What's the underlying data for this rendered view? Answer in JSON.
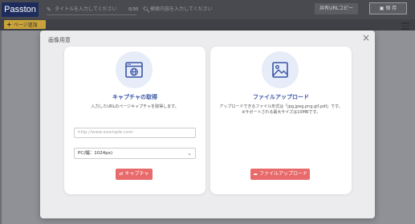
{
  "app": {
    "logo": "Passton",
    "title_placeholder": "タイトルを入力してください",
    "title_count": "0/30",
    "search_placeholder": "検索内容を入力してください",
    "share_label": "共有URLコピー",
    "save_label": "保 存",
    "page_add_label": "ページ追加"
  },
  "modal": {
    "title": "画像用意",
    "close_symbol": "×",
    "capture": {
      "title": "キャプチャの取得",
      "description": "入力したURLのページキャプチャを取得します。",
      "url_placeholder": "http://www.example.com",
      "size_value": "PC(幅：1024px)",
      "button_label": "キャプチャ"
    },
    "upload": {
      "title": "ファイルアップロード",
      "description_line1": "アップロードできるファイル形式は「jpg,jpeg,png,gif,pdf」です。",
      "description_line2": "※サポートされる最大サイズは10MBです。",
      "button_label": "ファイルアップロード"
    }
  },
  "colors": {
    "accent_blue": "#3a55a5",
    "button_red": "#e86a6a",
    "page_add_yellow": "#c9a33a",
    "logo_navy": "#1d2c5c"
  }
}
